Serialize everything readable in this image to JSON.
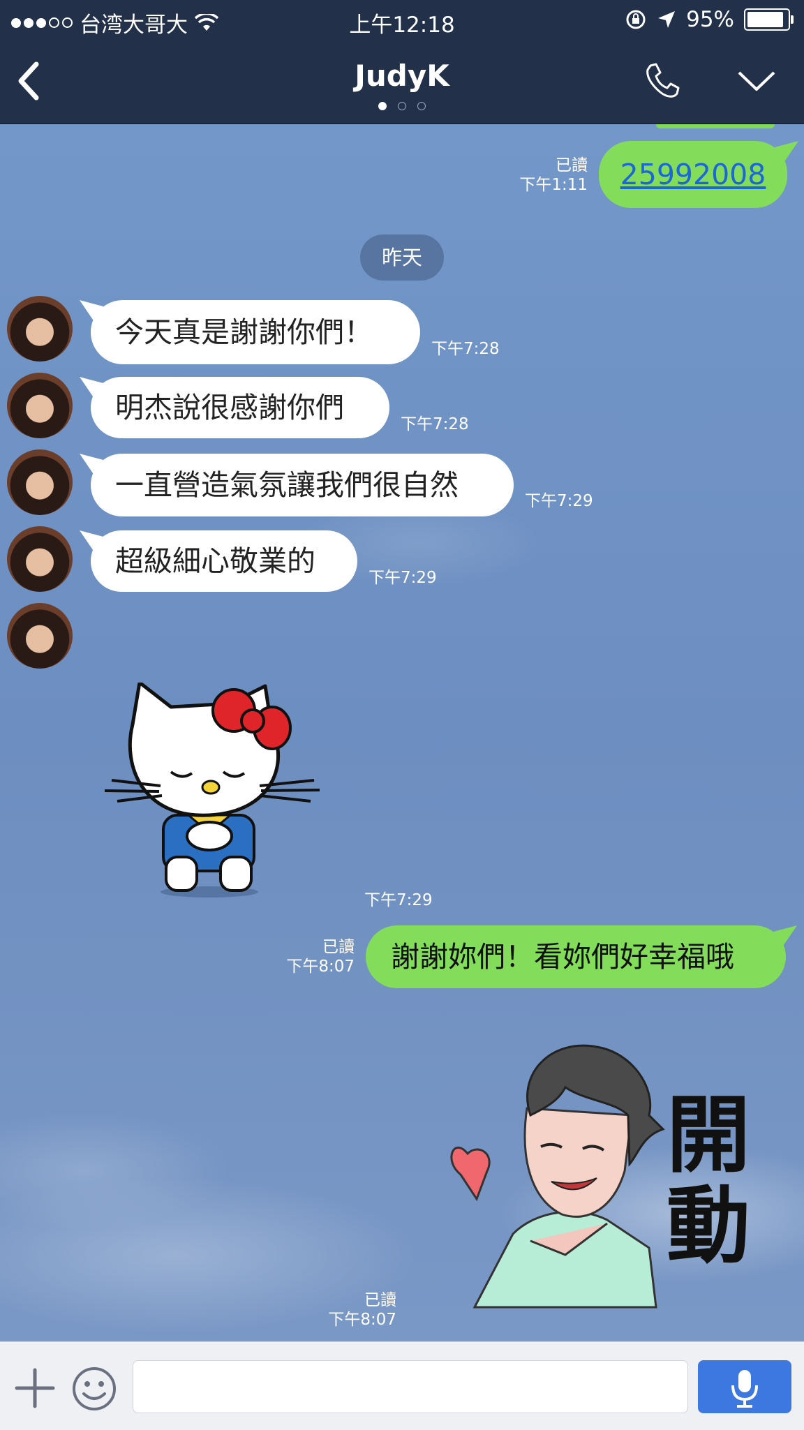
{
  "status_bar": {
    "carrier": "台湾大哥大",
    "time": "上午12:18",
    "battery": "95%",
    "battery_level": 0.95,
    "signal_bars": 3,
    "signal_total": 5
  },
  "nav": {
    "title": "JudyK",
    "page_count": 3,
    "active_page": 1,
    "icons": [
      "back-chevron-icon",
      "phone-icon",
      "chevron-down-icon"
    ]
  },
  "chat": {
    "top_message": {
      "text": "25992008",
      "read": "已讀",
      "time": "下午1:11"
    },
    "date_separator": "昨天",
    "incoming": [
      {
        "text": "今天真是謝謝你們！",
        "time": "下午7:28"
      },
      {
        "text": "明杰說很感謝你們",
        "time": "下午7:28"
      },
      {
        "text": "一直營造氣氛讓我們很自然",
        "time": "下午7:29"
      },
      {
        "text": "超級細心敬業的",
        "time": "下午7:29"
      }
    ],
    "incoming_sticker": {
      "sticker": "hello-kitty-bow-sticker",
      "time": "下午7:29"
    },
    "outgoing_message": {
      "text": "謝謝妳們！看妳們好幸福哦",
      "read": "已讀",
      "time": "下午8:07"
    },
    "outgoing_sticker": {
      "sticker": "smiling-man-heart-sticker",
      "caption": "開動",
      "read": "已讀",
      "time": "下午8:07"
    }
  },
  "input_bar": {
    "placeholder": "",
    "icons": [
      "plus-icon",
      "smiley-icon",
      "microphone-icon"
    ]
  },
  "colors": {
    "header": "#233049",
    "outgoing_bubble": "#84dd5a",
    "incoming_bubble": "#ffffff",
    "mic_button": "#3c78e0",
    "link": "#1b66d8"
  }
}
